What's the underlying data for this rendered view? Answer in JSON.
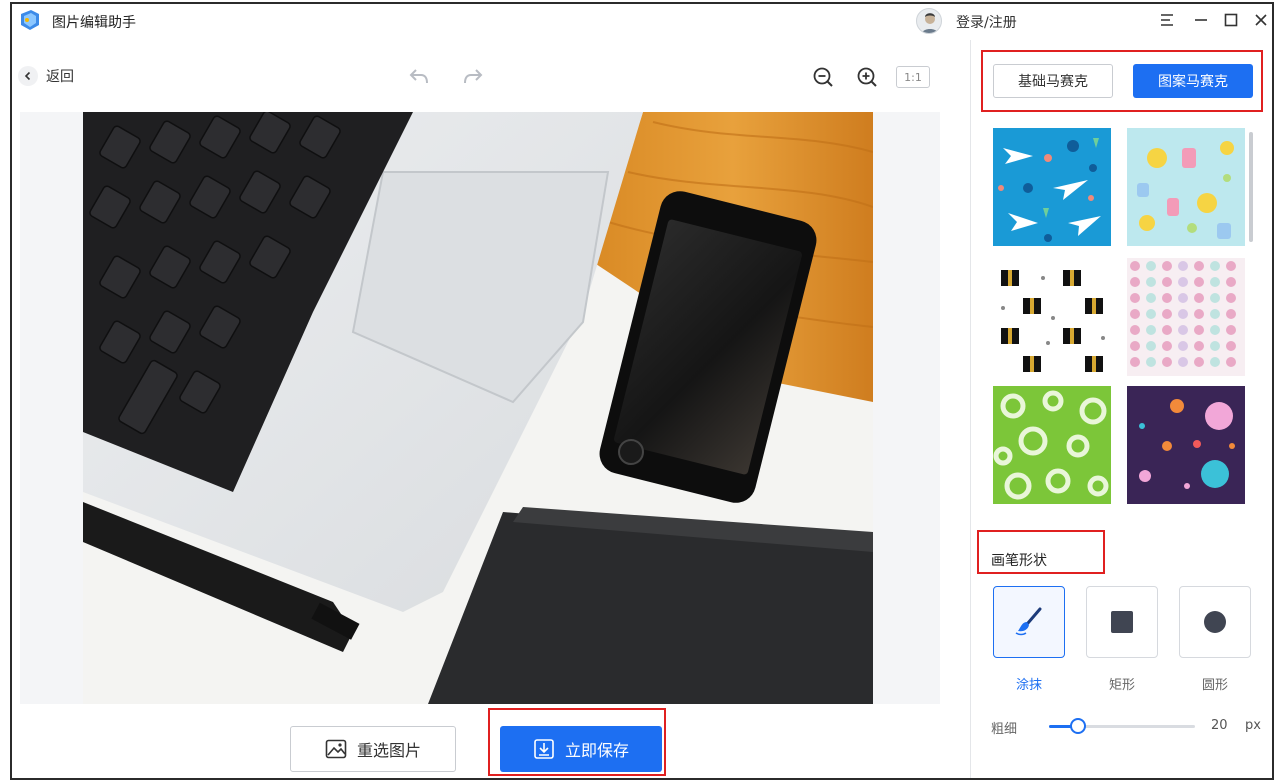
{
  "app": {
    "title": "图片编辑助手",
    "login_label": "登录/注册"
  },
  "toolbar": {
    "back_label": "返回",
    "ratio_label": "1:1"
  },
  "actions": {
    "reselect_label": "重选图片",
    "save_label": "立即保存"
  },
  "mosaic_tabs": [
    {
      "label": "基础马赛克",
      "active": false
    },
    {
      "label": "图案马赛克",
      "active": true
    }
  ],
  "patterns": [
    {
      "icon": "sharks-pattern"
    },
    {
      "icon": "baby-ducks-pattern"
    },
    {
      "icon": "gift-boxes-pattern"
    },
    {
      "icon": "pastel-dots-pattern"
    },
    {
      "icon": "green-rings-pattern"
    },
    {
      "icon": "purple-bubbles-pattern"
    }
  ],
  "brush": {
    "title": "画笔形状",
    "shapes": [
      {
        "label": "涂抹",
        "icon": "brush-icon",
        "active": true
      },
      {
        "label": "矩形",
        "icon": "square-icon",
        "active": false
      },
      {
        "label": "圆形",
        "icon": "circle-icon",
        "active": false
      }
    ],
    "size_label": "粗细",
    "size_value": "20",
    "size_unit": "px",
    "size_fraction": 0.2
  },
  "colors": {
    "accent": "#1d6ff2",
    "highlight_border": "#e02020"
  }
}
